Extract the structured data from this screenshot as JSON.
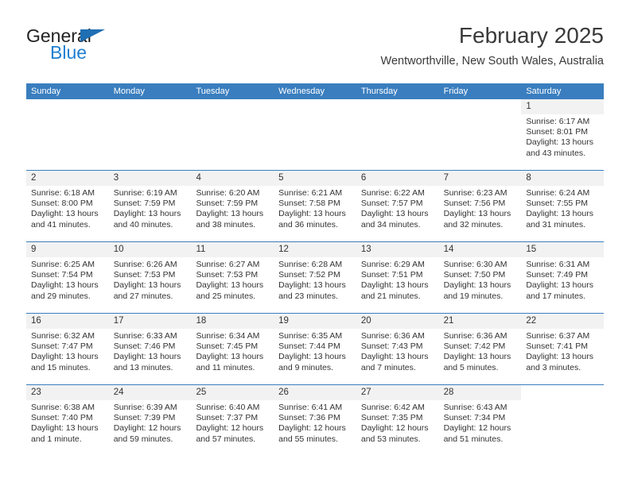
{
  "brand": {
    "word_one": "General",
    "word_two": "Blue",
    "triangle_icon": "triangle-logo-icon",
    "accent_color": "#1f7fd0",
    "triangle_color": "#1f6fb4"
  },
  "header": {
    "title": "February 2025",
    "subtitle": "Wentworthville, New South Wales, Australia"
  },
  "calendar": {
    "header_color": "#3a7ebf",
    "daynum_band_color": "#f2f2f2",
    "weekdays": [
      "Sunday",
      "Monday",
      "Tuesday",
      "Wednesday",
      "Thursday",
      "Friday",
      "Saturday"
    ],
    "weeks": [
      [
        {
          "day": "",
          "sunrise": "",
          "sunset": "",
          "daylight": "",
          "empty": true
        },
        {
          "day": "",
          "sunrise": "",
          "sunset": "",
          "daylight": "",
          "empty": true
        },
        {
          "day": "",
          "sunrise": "",
          "sunset": "",
          "daylight": "",
          "empty": true
        },
        {
          "day": "",
          "sunrise": "",
          "sunset": "",
          "daylight": "",
          "empty": true
        },
        {
          "day": "",
          "sunrise": "",
          "sunset": "",
          "daylight": "",
          "empty": true
        },
        {
          "day": "",
          "sunrise": "",
          "sunset": "",
          "daylight": "",
          "empty": true
        },
        {
          "day": "1",
          "sunrise": "Sunrise: 6:17 AM",
          "sunset": "Sunset: 8:01 PM",
          "daylight": "Daylight: 13 hours and 43 minutes.",
          "empty": false
        }
      ],
      [
        {
          "day": "2",
          "sunrise": "Sunrise: 6:18 AM",
          "sunset": "Sunset: 8:00 PM",
          "daylight": "Daylight: 13 hours and 41 minutes.",
          "empty": false
        },
        {
          "day": "3",
          "sunrise": "Sunrise: 6:19 AM",
          "sunset": "Sunset: 7:59 PM",
          "daylight": "Daylight: 13 hours and 40 minutes.",
          "empty": false
        },
        {
          "day": "4",
          "sunrise": "Sunrise: 6:20 AM",
          "sunset": "Sunset: 7:59 PM",
          "daylight": "Daylight: 13 hours and 38 minutes.",
          "empty": false
        },
        {
          "day": "5",
          "sunrise": "Sunrise: 6:21 AM",
          "sunset": "Sunset: 7:58 PM",
          "daylight": "Daylight: 13 hours and 36 minutes.",
          "empty": false
        },
        {
          "day": "6",
          "sunrise": "Sunrise: 6:22 AM",
          "sunset": "Sunset: 7:57 PM",
          "daylight": "Daylight: 13 hours and 34 minutes.",
          "empty": false
        },
        {
          "day": "7",
          "sunrise": "Sunrise: 6:23 AM",
          "sunset": "Sunset: 7:56 PM",
          "daylight": "Daylight: 13 hours and 32 minutes.",
          "empty": false
        },
        {
          "day": "8",
          "sunrise": "Sunrise: 6:24 AM",
          "sunset": "Sunset: 7:55 PM",
          "daylight": "Daylight: 13 hours and 31 minutes.",
          "empty": false
        }
      ],
      [
        {
          "day": "9",
          "sunrise": "Sunrise: 6:25 AM",
          "sunset": "Sunset: 7:54 PM",
          "daylight": "Daylight: 13 hours and 29 minutes.",
          "empty": false
        },
        {
          "day": "10",
          "sunrise": "Sunrise: 6:26 AM",
          "sunset": "Sunset: 7:53 PM",
          "daylight": "Daylight: 13 hours and 27 minutes.",
          "empty": false
        },
        {
          "day": "11",
          "sunrise": "Sunrise: 6:27 AM",
          "sunset": "Sunset: 7:53 PM",
          "daylight": "Daylight: 13 hours and 25 minutes.",
          "empty": false
        },
        {
          "day": "12",
          "sunrise": "Sunrise: 6:28 AM",
          "sunset": "Sunset: 7:52 PM",
          "daylight": "Daylight: 13 hours and 23 minutes.",
          "empty": false
        },
        {
          "day": "13",
          "sunrise": "Sunrise: 6:29 AM",
          "sunset": "Sunset: 7:51 PM",
          "daylight": "Daylight: 13 hours and 21 minutes.",
          "empty": false
        },
        {
          "day": "14",
          "sunrise": "Sunrise: 6:30 AM",
          "sunset": "Sunset: 7:50 PM",
          "daylight": "Daylight: 13 hours and 19 minutes.",
          "empty": false
        },
        {
          "day": "15",
          "sunrise": "Sunrise: 6:31 AM",
          "sunset": "Sunset: 7:49 PM",
          "daylight": "Daylight: 13 hours and 17 minutes.",
          "empty": false
        }
      ],
      [
        {
          "day": "16",
          "sunrise": "Sunrise: 6:32 AM",
          "sunset": "Sunset: 7:47 PM",
          "daylight": "Daylight: 13 hours and 15 minutes.",
          "empty": false
        },
        {
          "day": "17",
          "sunrise": "Sunrise: 6:33 AM",
          "sunset": "Sunset: 7:46 PM",
          "daylight": "Daylight: 13 hours and 13 minutes.",
          "empty": false
        },
        {
          "day": "18",
          "sunrise": "Sunrise: 6:34 AM",
          "sunset": "Sunset: 7:45 PM",
          "daylight": "Daylight: 13 hours and 11 minutes.",
          "empty": false
        },
        {
          "day": "19",
          "sunrise": "Sunrise: 6:35 AM",
          "sunset": "Sunset: 7:44 PM",
          "daylight": "Daylight: 13 hours and 9 minutes.",
          "empty": false
        },
        {
          "day": "20",
          "sunrise": "Sunrise: 6:36 AM",
          "sunset": "Sunset: 7:43 PM",
          "daylight": "Daylight: 13 hours and 7 minutes.",
          "empty": false
        },
        {
          "day": "21",
          "sunrise": "Sunrise: 6:36 AM",
          "sunset": "Sunset: 7:42 PM",
          "daylight": "Daylight: 13 hours and 5 minutes.",
          "empty": false
        },
        {
          "day": "22",
          "sunrise": "Sunrise: 6:37 AM",
          "sunset": "Sunset: 7:41 PM",
          "daylight": "Daylight: 13 hours and 3 minutes.",
          "empty": false
        }
      ],
      [
        {
          "day": "23",
          "sunrise": "Sunrise: 6:38 AM",
          "sunset": "Sunset: 7:40 PM",
          "daylight": "Daylight: 13 hours and 1 minute.",
          "empty": false
        },
        {
          "day": "24",
          "sunrise": "Sunrise: 6:39 AM",
          "sunset": "Sunset: 7:39 PM",
          "daylight": "Daylight: 12 hours and 59 minutes.",
          "empty": false
        },
        {
          "day": "25",
          "sunrise": "Sunrise: 6:40 AM",
          "sunset": "Sunset: 7:37 PM",
          "daylight": "Daylight: 12 hours and 57 minutes.",
          "empty": false
        },
        {
          "day": "26",
          "sunrise": "Sunrise: 6:41 AM",
          "sunset": "Sunset: 7:36 PM",
          "daylight": "Daylight: 12 hours and 55 minutes.",
          "empty": false
        },
        {
          "day": "27",
          "sunrise": "Sunrise: 6:42 AM",
          "sunset": "Sunset: 7:35 PM",
          "daylight": "Daylight: 12 hours and 53 minutes.",
          "empty": false
        },
        {
          "day": "28",
          "sunrise": "Sunrise: 6:43 AM",
          "sunset": "Sunset: 7:34 PM",
          "daylight": "Daylight: 12 hours and 51 minutes.",
          "empty": false
        },
        {
          "day": "",
          "sunrise": "",
          "sunset": "",
          "daylight": "",
          "empty": true
        }
      ]
    ]
  }
}
